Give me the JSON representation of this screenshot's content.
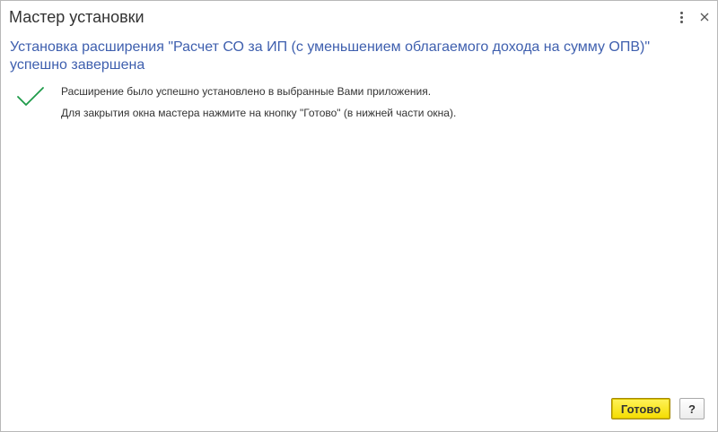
{
  "window": {
    "title": "Мастер установки",
    "menu_icon": "kebab-menu-icon",
    "close_label": "×"
  },
  "content": {
    "heading": "Установка расширения \"Расчет СО за ИП (с уменьшением облагаемого дохода на сумму ОПВ)\" успешно завершена",
    "status_icon": "checkmark-icon",
    "status_color": "#1f9b4a",
    "message_installed": "Расширение было успешно установлено в выбранные Вами приложения.",
    "message_close_hint": "Для закрытия окна мастера нажмите на кнопку \"Готово\" (в нижней части окна)."
  },
  "footer": {
    "done_label": "Готово",
    "help_label": "?"
  },
  "colors": {
    "heading": "#3e5fae",
    "done_button": "#f5dc00",
    "text": "#333333"
  }
}
